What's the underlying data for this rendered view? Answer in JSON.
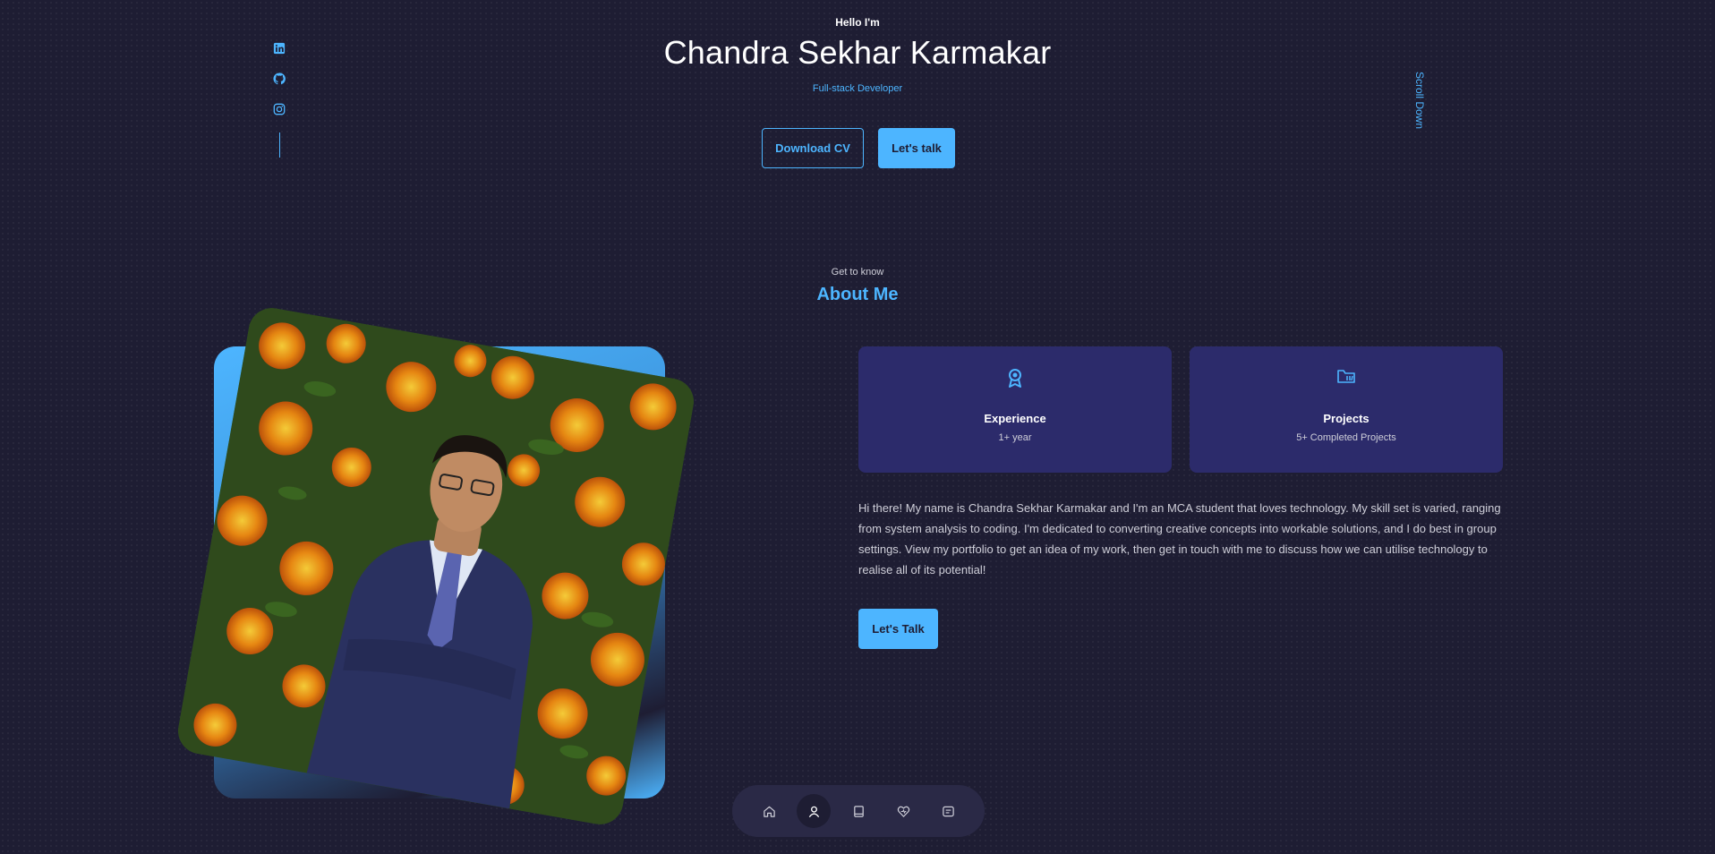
{
  "hero": {
    "greeting": "Hello I'm",
    "name": "Chandra Sekhar Karmakar",
    "role": "Full-stack Developer",
    "download_cv_label": "Download CV",
    "lets_talk_label": "Let's talk",
    "scroll_down_label": "Scroll Down"
  },
  "socials": {
    "icons": [
      "linkedin-icon",
      "github-icon",
      "instagram-icon"
    ]
  },
  "about": {
    "eyebrow": "Get to know",
    "title": "About Me",
    "cards": [
      {
        "icon": "award-icon",
        "title": "Experience",
        "subtitle": "1+ year"
      },
      {
        "icon": "folder-icon",
        "title": "Projects",
        "subtitle": "5+ Completed Projects"
      }
    ],
    "description": "Hi there! My name is Chandra Sekhar Karmakar and I'm an MCA student that loves technology. My skill set is varied, ranging from system analysis to coding. I'm dedicated to converting creative concepts into workable solutions, and I do best in group settings. View my portfolio to get an idea of my work, then get in touch with me to discuss how we can utilise technology to realise all of its potential!",
    "cta_label": "Let's Talk"
  },
  "nav": {
    "items": [
      {
        "icon": "home-icon",
        "active": false
      },
      {
        "icon": "user-icon",
        "active": true
      },
      {
        "icon": "book-icon",
        "active": false
      },
      {
        "icon": "services-icon",
        "active": false
      },
      {
        "icon": "message-icon",
        "active": false
      }
    ]
  },
  "colors": {
    "background": "#1e1d33",
    "accent": "#4db5ff",
    "card": "#2c2b6b"
  }
}
